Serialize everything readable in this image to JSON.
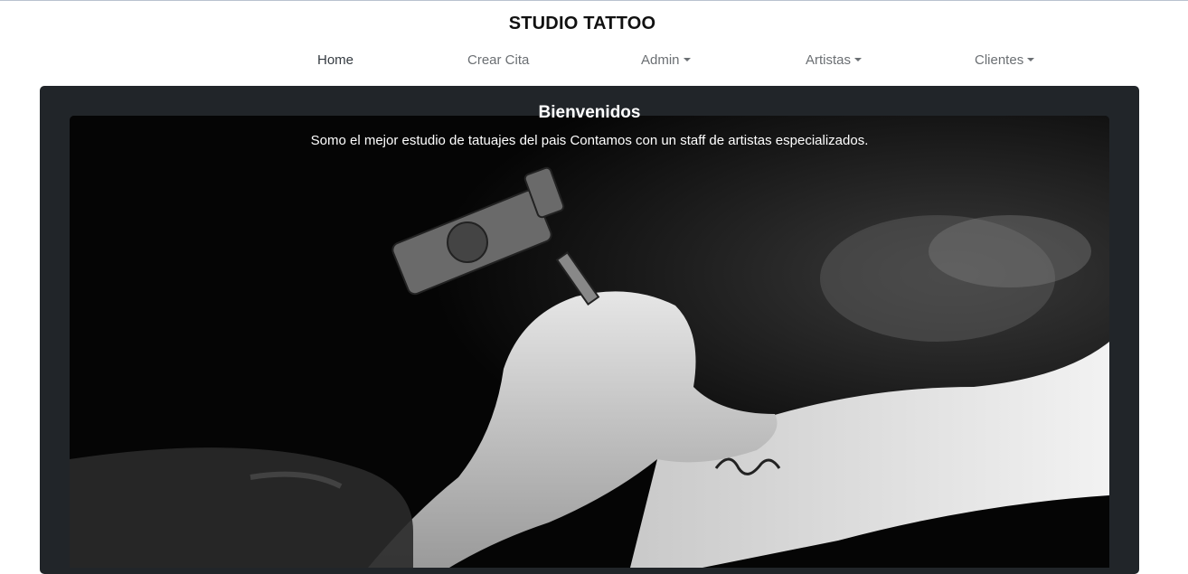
{
  "header": {
    "brand": "STUDIO TATTOO"
  },
  "nav": {
    "home": "Home",
    "crear_cita": "Crear Cita",
    "admin": "Admin",
    "artistas": "Artistas",
    "clientes": "Clientes"
  },
  "hero": {
    "title": "Bienvenidos",
    "text": "Somo el mejor estudio de tatuajes del pais Contamos con un staff de artistas especializados.",
    "image_subject": "tattoo-artist-working-black-and-white-photo"
  },
  "colors": {
    "panel_bg": "#212529",
    "nav_text": "#6b6f73",
    "nav_active": "#343a40"
  }
}
